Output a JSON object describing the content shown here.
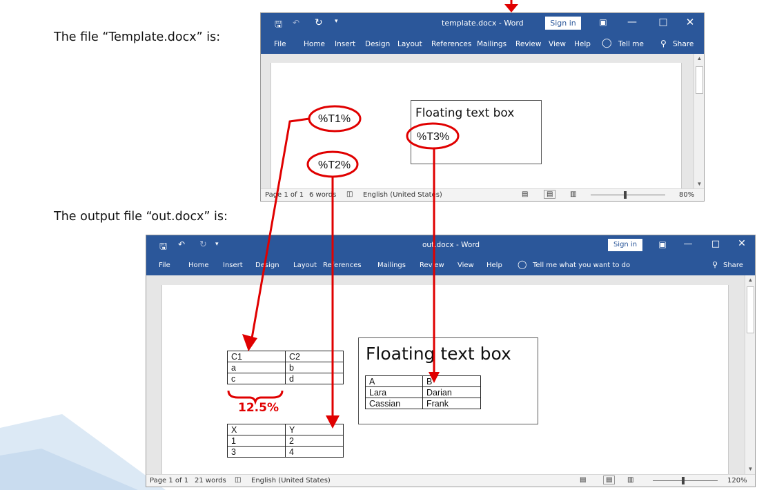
{
  "captions": {
    "template_caption": "The file “Template.docx” is:",
    "output_caption": "The output file “out.docx” is:"
  },
  "template_window": {
    "title": "template.docx  -  Word",
    "sign_in": "Sign in",
    "menu": [
      "File",
      "Home",
      "Insert",
      "Design",
      "Layout",
      "References",
      "Mailings",
      "Review",
      "View",
      "Help",
      "Tell me",
      "Share"
    ],
    "placeholders": {
      "t1": "%T1%",
      "t2": "%T2%",
      "t3": "%T3%"
    },
    "textbox_title": "Floating text box",
    "status": {
      "page": "Page 1 of 1",
      "words": "6 words",
      "language": "English (United States)",
      "zoom": "80%"
    }
  },
  "output_window": {
    "title": "out.docx  -  Word",
    "sign_in": "Sign in",
    "menu": [
      "File",
      "Home",
      "Insert",
      "Design",
      "Layout",
      "References",
      "Mailings",
      "Review",
      "View",
      "Help",
      "Tell me what you want to do",
      "Share"
    ],
    "textbox_title": "Floating text box",
    "table1": [
      [
        "C1",
        "C2"
      ],
      [
        "a",
        "b"
      ],
      [
        "c",
        "d"
      ]
    ],
    "table1_width_label": "12.5%",
    "table2": [
      [
        "X",
        "Y"
      ],
      [
        "1",
        "2"
      ],
      [
        "3",
        "4"
      ]
    ],
    "table3": [
      [
        "A",
        "B"
      ],
      [
        "Lara",
        "Darian"
      ],
      [
        "Cassian",
        "Frank"
      ]
    ],
    "status": {
      "page": "Page 1 of 1",
      "words": "21 words",
      "language": "English (United States)",
      "zoom": "120%"
    }
  },
  "colors": {
    "word_blue": "#2b579a",
    "annotation_red": "#e00000"
  },
  "icons": [
    "save-icon",
    "undo-icon",
    "redo-icon",
    "customize-icon",
    "ribbon-display-icon",
    "minimize-icon",
    "maximize-icon",
    "close-icon",
    "lightbulb-icon",
    "share-icon",
    "read-mode-icon",
    "print-layout-icon",
    "web-layout-icon",
    "proofing-icon"
  ]
}
